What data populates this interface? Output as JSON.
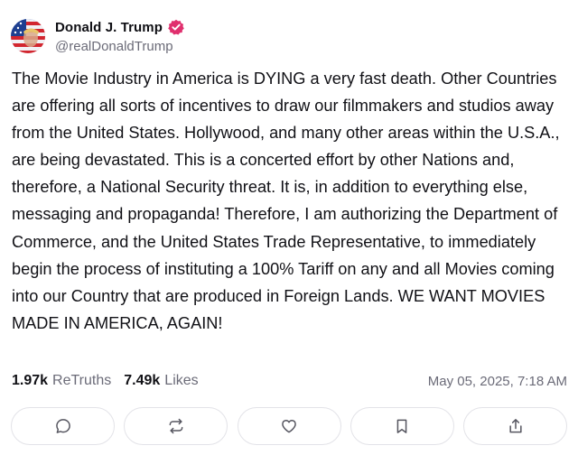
{
  "post": {
    "author": {
      "display_name": "Donald J. Trump",
      "handle": "@realDonaldTrump",
      "verified": true,
      "avatar_icon": "profile-avatar-flag"
    },
    "text": "The Movie Industry in America is DYING a very fast death. Other Countries are offering all sorts of incentives to draw our filmmakers and studios away from the United States. Hollywood, and many other areas within the U.S.A., are being devastated. This is a concerted effort by other Nations and, therefore, a National Security threat. It is, in addition to everything else, messaging and propaganda! Therefore, I am authorizing the Department of Commerce, and the United States Trade Representative, to immediately begin the process of instituting a 100% Tariff on any and all Movies coming into our Country that are produced in Foreign Lands. WE WANT MOVIES MADE IN AMERICA, AGAIN!",
    "stats": {
      "retruths_count": "1.97k",
      "retruths_label": "ReTruths",
      "likes_count": "7.49k",
      "likes_label": "Likes"
    },
    "timestamp": "May 05, 2025, 7:18 AM",
    "actions": [
      {
        "icon": "reply-icon"
      },
      {
        "icon": "retruth-icon"
      },
      {
        "icon": "like-icon"
      },
      {
        "icon": "bookmark-icon"
      },
      {
        "icon": "share-icon"
      }
    ]
  },
  "colors": {
    "verified_badge": "#e0306e",
    "text_primary": "#111116",
    "text_secondary": "#6b6b78",
    "border": "#e3e3e8"
  }
}
